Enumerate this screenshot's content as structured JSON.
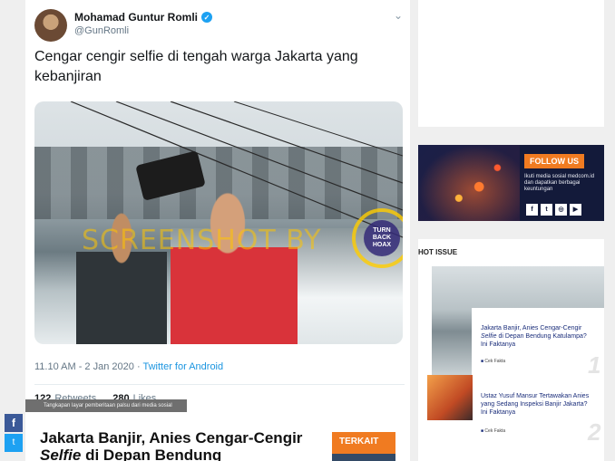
{
  "tweet": {
    "author_name": "Mohamad Guntur Romli",
    "handle": "@GunRomli",
    "text": "Cengar cengir selfie di tengah warga Jakarta yang kebanjiran",
    "timestamp": "11.10 AM - 2 Jan 2020",
    "via": "Twitter for Android",
    "retweets_count": "122",
    "retweets_label": "Retweets",
    "likes_count": "280",
    "likes_label": "Likes",
    "watermark": "SCREENSHOT BY",
    "seal_text": "TURN BACK HOAX"
  },
  "caption": "Tangkapan layar pemberitaan palsu dari media sosial",
  "article": {
    "headline_part1": "Jakarta Banjir, Anies Cengar-Cengir ",
    "headline_italic": "Selfie",
    "headline_part2": " di Depan Bendung",
    "related_label": "TERKAIT"
  },
  "share": {
    "facebook_icon": "f",
    "twitter_icon": "t"
  },
  "sidebar": {
    "follow_title": "FOLLOW US",
    "follow_sub": "Ikuti media sosial medcom.id dan dapatkan berbagai keuntungan",
    "social_icons": [
      "f",
      "t",
      "◎",
      "▶"
    ],
    "hot_issue_title": "HOT ISSUE",
    "hot_items": [
      {
        "title_part1": "Jakarta Banjir, Anies Cengar-Cengir ",
        "title_italic": "Selfie",
        "title_part2": " di Depan Bendung Katulampa? Ini Faktanya",
        "category": "Cek Fakta",
        "number": "1"
      },
      {
        "title": "Ustaz Yusuf Mansur Tertawakan Anies yang Sedang Inspeksi Banjir Jakarta? Ini Faktanya",
        "category": "Cek Fakta",
        "number": "2"
      }
    ]
  },
  "colors": {
    "accent": "#f07b21",
    "twitter_blue": "#1da1f2",
    "link_blue": "#1a2d7a"
  }
}
